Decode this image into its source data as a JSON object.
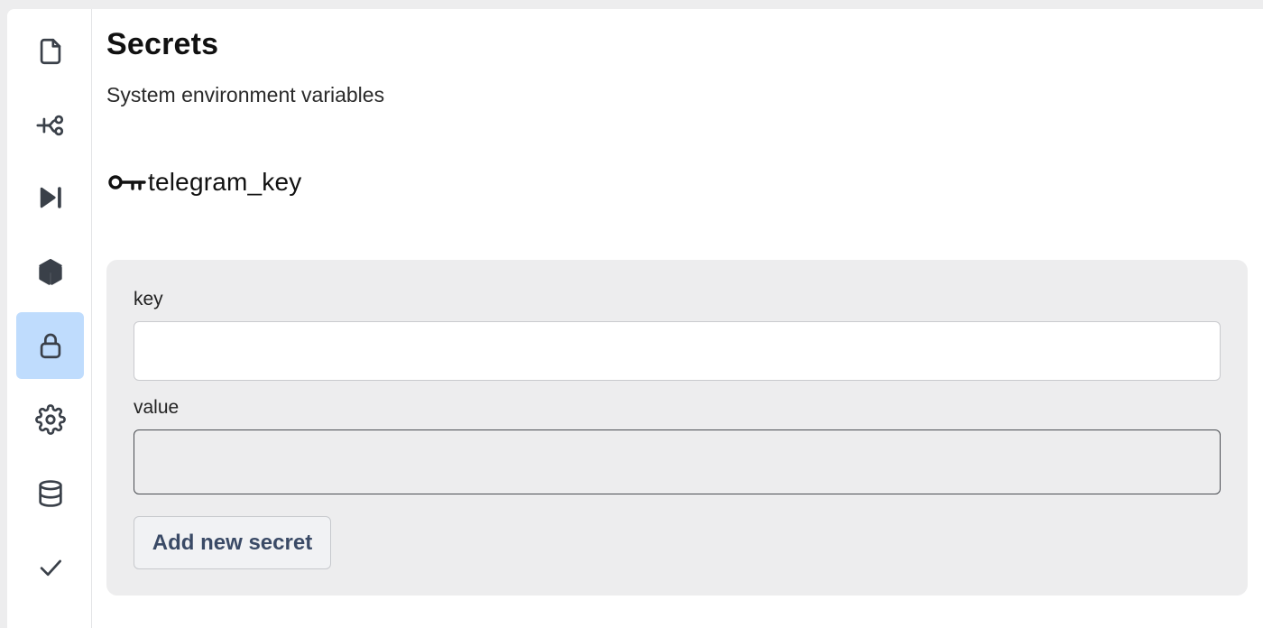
{
  "sidebar": {
    "items": [
      {
        "icon": "file-icon",
        "active": false
      },
      {
        "icon": "flow-icon",
        "active": false
      },
      {
        "icon": "play-skip-icon",
        "active": false
      },
      {
        "icon": "package-icon",
        "active": false
      },
      {
        "icon": "lock-icon",
        "active": true
      },
      {
        "icon": "gear-icon",
        "active": false
      },
      {
        "icon": "database-icon",
        "active": false
      },
      {
        "icon": "check-icon",
        "active": false
      }
    ],
    "active_color": "#bfdcfd"
  },
  "page": {
    "title": "Secrets",
    "subtitle": "System environment variables"
  },
  "secrets": [
    {
      "icon": "key-icon",
      "name": "telegram_key"
    }
  ],
  "form": {
    "key_label": "key",
    "key_value": "",
    "value_label": "value",
    "value_value": "",
    "submit_label": "Add new secret"
  }
}
